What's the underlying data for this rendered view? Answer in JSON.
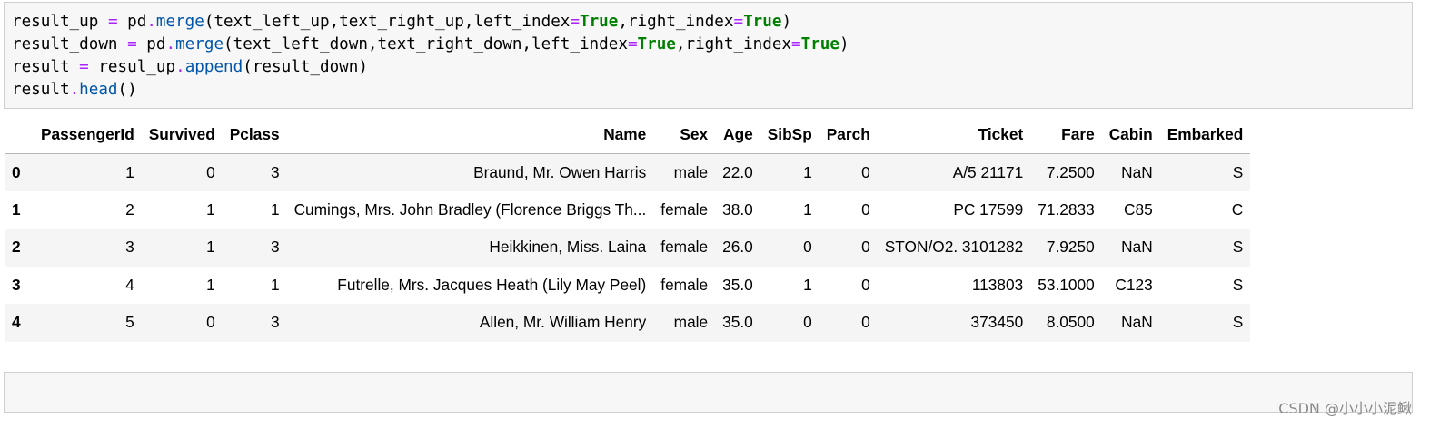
{
  "code_cell": {
    "lines": [
      [
        {
          "t": "result_up ",
          "c": ""
        },
        {
          "t": "=",
          "c": "op"
        },
        {
          "t": " pd",
          "c": ""
        },
        {
          "t": ".",
          "c": "op"
        },
        {
          "t": "merge",
          "c": "fn"
        },
        {
          "t": "(text_left_up,text_right_up,left_index",
          "c": ""
        },
        {
          "t": "=",
          "c": "op"
        },
        {
          "t": "True",
          "c": "kw"
        },
        {
          "t": ",right_index",
          "c": ""
        },
        {
          "t": "=",
          "c": "op"
        },
        {
          "t": "True",
          "c": "kw"
        },
        {
          "t": ")",
          "c": ""
        }
      ],
      [
        {
          "t": "result_down ",
          "c": ""
        },
        {
          "t": "=",
          "c": "op"
        },
        {
          "t": " pd",
          "c": ""
        },
        {
          "t": ".",
          "c": "op"
        },
        {
          "t": "merge",
          "c": "fn"
        },
        {
          "t": "(text_left_down,text_right_down,left_index",
          "c": ""
        },
        {
          "t": "=",
          "c": "op"
        },
        {
          "t": "True",
          "c": "kw"
        },
        {
          "t": ",right_index",
          "c": ""
        },
        {
          "t": "=",
          "c": "op"
        },
        {
          "t": "True",
          "c": "kw"
        },
        {
          "t": ")",
          "c": ""
        }
      ],
      [
        {
          "t": "result ",
          "c": ""
        },
        {
          "t": "=",
          "c": "op"
        },
        {
          "t": " resul_up",
          "c": ""
        },
        {
          "t": ".",
          "c": "op"
        },
        {
          "t": "append",
          "c": "fn"
        },
        {
          "t": "(result_down)",
          "c": ""
        }
      ],
      [
        {
          "t": "result",
          "c": ""
        },
        {
          "t": ".",
          "c": "op"
        },
        {
          "t": "head",
          "c": "fn"
        },
        {
          "t": "()",
          "c": ""
        }
      ]
    ]
  },
  "output_table": {
    "columns": [
      "",
      "PassengerId",
      "Survived",
      "Pclass",
      "Name",
      "Sex",
      "Age",
      "SibSp",
      "Parch",
      "Ticket",
      "Fare",
      "Cabin",
      "Embarked"
    ],
    "rows": [
      [
        "0",
        "1",
        "0",
        "3",
        "Braund, Mr. Owen Harris",
        "male",
        "22.0",
        "1",
        "0",
        "A/5 21171",
        "7.2500",
        "NaN",
        "S"
      ],
      [
        "1",
        "2",
        "1",
        "1",
        "Cumings, Mrs. John Bradley (Florence Briggs Th...",
        "female",
        "38.0",
        "1",
        "0",
        "PC 17599",
        "71.2833",
        "C85",
        "C"
      ],
      [
        "2",
        "3",
        "1",
        "3",
        "Heikkinen, Miss. Laina",
        "female",
        "26.0",
        "0",
        "0",
        "STON/O2. 3101282",
        "7.9250",
        "NaN",
        "S"
      ],
      [
        "3",
        "4",
        "1",
        "1",
        "Futrelle, Mrs. Jacques Heath (Lily May Peel)",
        "female",
        "35.0",
        "1",
        "0",
        "113803",
        "53.1000",
        "C123",
        "S"
      ],
      [
        "4",
        "5",
        "0",
        "3",
        "Allen, Mr. William Henry",
        "male",
        "35.0",
        "0",
        "0",
        "373450",
        "8.0500",
        "NaN",
        "S"
      ]
    ]
  },
  "empty_cell": {
    "content": ""
  },
  "watermark": {
    "text": "CSDN @小小小泥鳅"
  },
  "colors": {
    "cell_background": "#f7f7f7",
    "cell_border": "#cfcfcf",
    "syntax_operator": "#aa22ff",
    "syntax_function": "#0055aa",
    "syntax_keyword": "#008000",
    "table_stripe": "#f5f5f5",
    "watermark": "#8a8a8a"
  }
}
